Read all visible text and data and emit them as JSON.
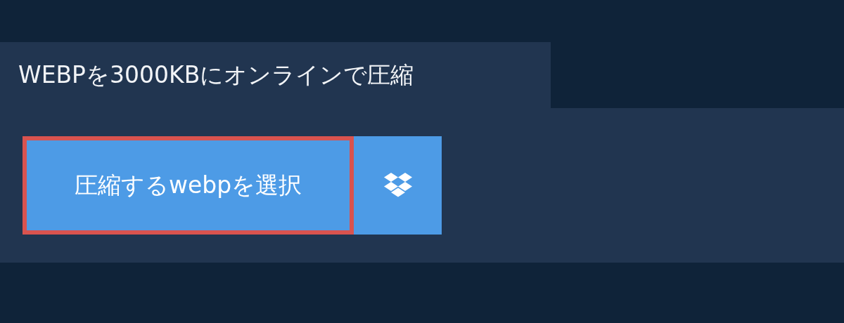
{
  "header": {
    "title": "WEBPを3000KBにオンラインで圧縮"
  },
  "upload": {
    "select_button": {
      "label": "圧縮するwebpを選択",
      "focused": true
    }
  }
}
